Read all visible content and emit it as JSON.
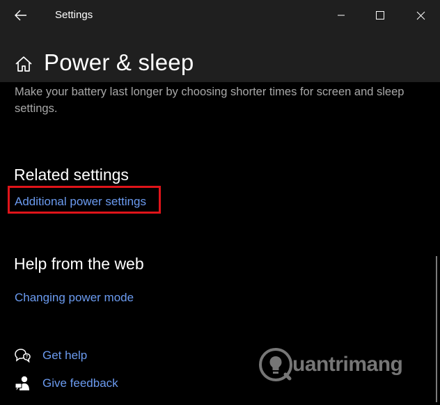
{
  "window": {
    "title": "Settings"
  },
  "header": {
    "title": "Power & sleep",
    "description": "Make your battery last longer by choosing shorter times for screen and sleep settings."
  },
  "related_settings": {
    "heading": "Related settings",
    "link": "Additional power settings"
  },
  "help_web": {
    "heading": "Help from the web",
    "link": "Changing power mode"
  },
  "actions": {
    "get_help": "Get help",
    "give_feedback": "Give feedback"
  },
  "watermark": {
    "text": "uantrimang"
  },
  "colors": {
    "background": "#000000",
    "titlebar": "#1f1f1f",
    "link": "#6b9bf0",
    "highlight": "#e0141a",
    "description": "#a8a8a8"
  },
  "icons": {
    "back": "back-arrow-icon",
    "minimize": "minimize-icon",
    "maximize": "maximize-icon",
    "close": "close-icon",
    "home": "home-icon",
    "help": "chat-help-icon",
    "feedback": "feedback-icon",
    "watermark_logo": "lightbulb-logo-icon"
  }
}
